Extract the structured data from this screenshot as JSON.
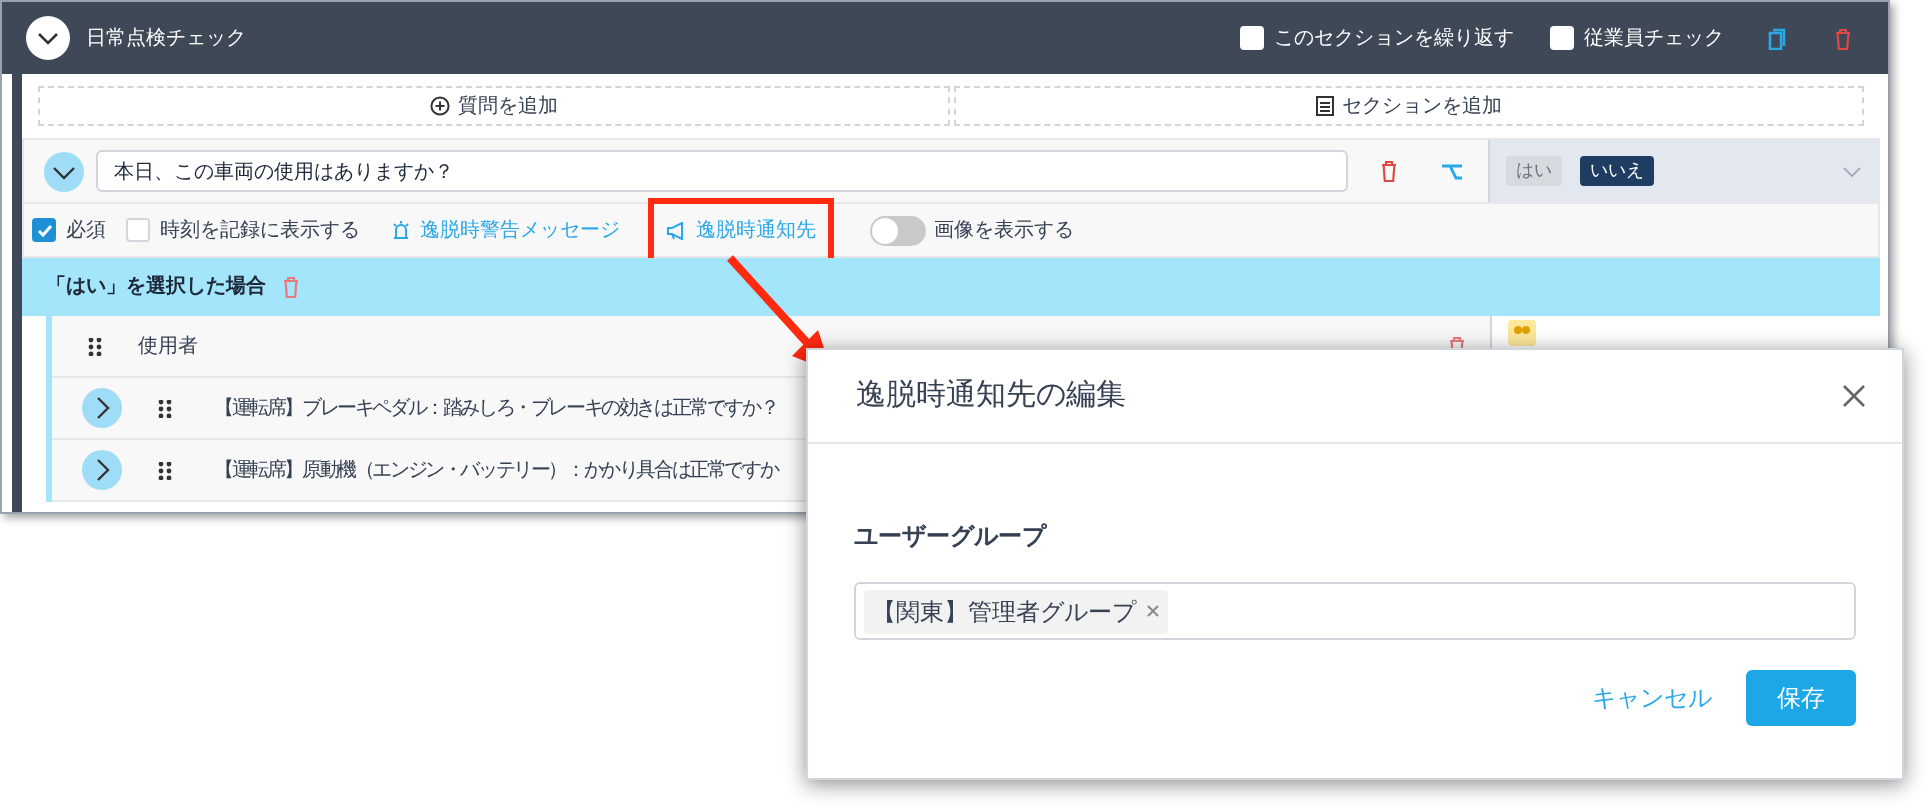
{
  "section": {
    "title": "日常点検チェック",
    "repeat_section": {
      "label": "このセクションを繰り返す",
      "checked": false
    },
    "employee_check": {
      "label": "従業員チェック",
      "checked": false
    }
  },
  "add_buttons": [
    {
      "label": "質問を追加"
    },
    {
      "label": "セクションを追加"
    }
  ],
  "question": {
    "text": "本日、この車両の使用はありますか？",
    "answers": [
      {
        "label": "はい",
        "selected": false
      },
      {
        "label": "いいえ",
        "selected": true
      }
    ],
    "options": [
      {
        "kind": "checkbox",
        "label": "必須",
        "checked": true
      },
      {
        "kind": "checkbox",
        "label": "時刻を記録に表示する",
        "checked": false
      },
      {
        "kind": "link",
        "label": "逸脱時警告メッセージ",
        "highlighted": false
      },
      {
        "kind": "link",
        "label": "逸脱時通知先",
        "highlighted": true
      },
      {
        "kind": "toggle",
        "label": "画像を表示する",
        "on": false
      }
    ]
  },
  "branch": {
    "title": "「はい」を選択した場合",
    "rows": [
      {
        "kind": "field",
        "label": "使用者"
      },
      {
        "kind": "question",
        "label": "【運転席】ブレーキペダル：踏みしろ・ブレーキの効きは正常ですか？"
      },
      {
        "kind": "question",
        "label": "【運転席】原動機（エンジン・バッテリー）：かかり具合は正常ですか"
      }
    ]
  },
  "dialog": {
    "title": "逸脱時通知先の編集",
    "field_label": "ユーザーグループ",
    "tags": [
      "【関東】管理者グループ"
    ],
    "buttons": [
      {
        "label": "キャンセル",
        "kind": "secondary"
      },
      {
        "label": "保存",
        "kind": "primary"
      }
    ]
  }
}
